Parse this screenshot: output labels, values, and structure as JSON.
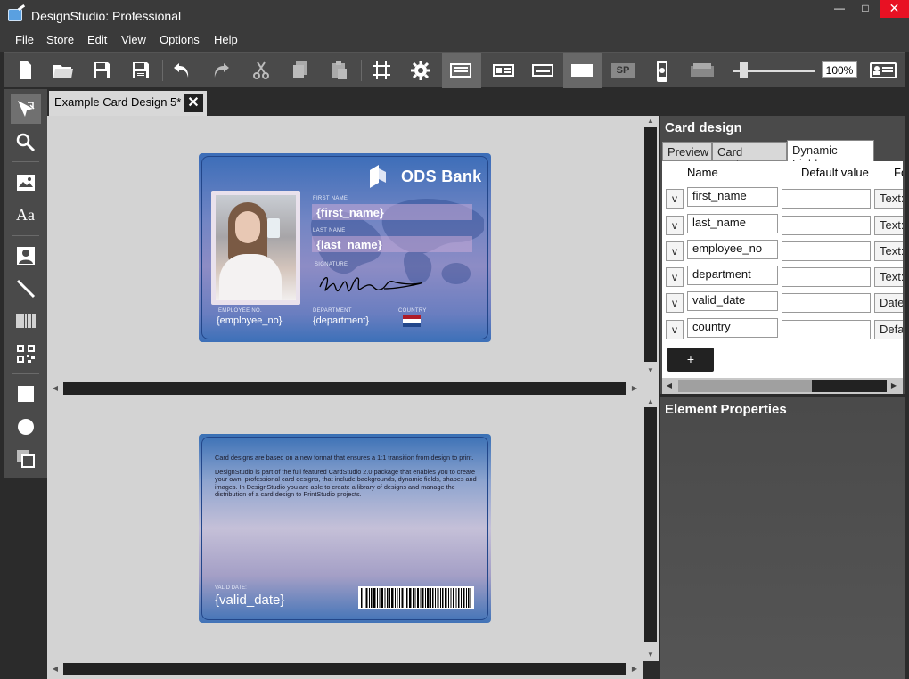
{
  "window": {
    "title": "DesignStudio: Professional",
    "min_glyph": "—",
    "max_glyph": "□",
    "close_glyph": "✕"
  },
  "menu": [
    "File",
    "Store",
    "Edit",
    "View",
    "Options",
    "Help"
  ],
  "toolbar": {
    "buttons": [
      "new-document",
      "open-folder",
      "save",
      "save-as",
      "undo",
      "redo",
      "cut",
      "copy",
      "paste",
      "grid",
      "settings",
      "card-view-front",
      "card-view-both",
      "card-view-stripe",
      "card-blank",
      "sp",
      "mobile",
      "card-reader",
      "slider",
      "zoom",
      "print-preview"
    ],
    "sp_label": "SP",
    "zoom": "100%",
    "zoom_level": 0.1
  },
  "tools": [
    "select",
    "zoom",
    "image",
    "text",
    "photo",
    "line",
    "barcode",
    "qrcode",
    "rectangle",
    "ellipse",
    "layers"
  ],
  "tools_text_label": "Aa",
  "document_tab": {
    "label": "Example Card Design 5*",
    "close": "✕"
  },
  "card_front": {
    "bank_name": "ODS Bank",
    "first_name_label": "FIRST NAME",
    "first_name_value": "{first_name}",
    "last_name_label": "LAST NAME",
    "last_name_value": "{last_name}",
    "signature_label": "SIGNATURE",
    "employee_no_label": "EMPLOYEE NO.",
    "employee_no_value": "{employee_no}",
    "department_label": "DEPARTMENT",
    "department_value": "{department}",
    "country_label": "COUNTRY",
    "flag_colors": [
      "#ae1c28",
      "#ffffff",
      "#21468b"
    ]
  },
  "card_back": {
    "paragraph1": "Card designs are based on a new format that ensures a 1:1 transition from design to print.",
    "paragraph2": "DesignStudio is part of the full featured CardStudio 2.0 package that enables you to create your own, professional card designs, that include backgrounds, dynamic fields, shapes and images. In DesignStudio you are able to create a library of designs and manage the distribution of a card design to PrintStudio projects.",
    "valid_date_label": "VALID DATE:",
    "valid_date_value": "{valid_date}"
  },
  "right_panel": {
    "title": "Card design",
    "tabs": [
      "Preview",
      "Card settings",
      "Dynamic Fields"
    ],
    "active_tab": "Dynamic Fields",
    "columns": [
      "Name",
      "Default value",
      "Fo"
    ],
    "rows": [
      {
        "v": "v",
        "name": "first_name",
        "default": "",
        "type": "Text:"
      },
      {
        "v": "v",
        "name": "last_name",
        "default": "",
        "type": "Text:"
      },
      {
        "v": "v",
        "name": "employee_no",
        "default": "",
        "type": "Text:"
      },
      {
        "v": "v",
        "name": "department",
        "default": "",
        "type": "Text:"
      },
      {
        "v": "v",
        "name": "valid_date",
        "default": "",
        "type": "Date"
      },
      {
        "v": "v",
        "name": "country",
        "default": "",
        "type": "Defa"
      }
    ],
    "add_label": "+"
  },
  "element_properties": {
    "title": "Element Properties"
  },
  "colors": {
    "close_red": "#e81123",
    "canvas_gray": "#d3d3d3",
    "panel_dark": "#4a4a4a"
  }
}
